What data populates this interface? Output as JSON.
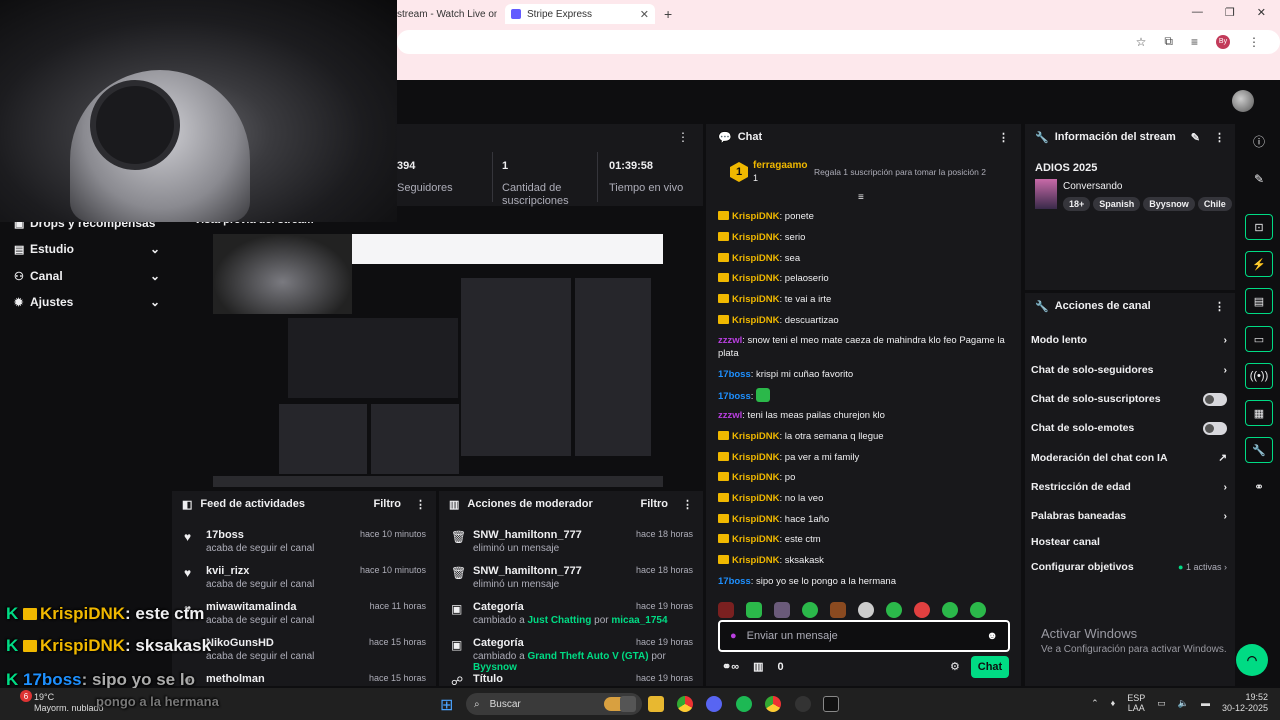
{
  "browser": {
    "tab1_title": "stream - Watch Live on",
    "tab2_title": "Stripe Express",
    "tab_close": "✕",
    "new_tab": "+",
    "profile_initials": "By"
  },
  "stats": {
    "followers_value": "394",
    "followers_label": "Seguidores",
    "subs_value": "1",
    "subs_label": "Cantidad de suscripciones",
    "live_value": "01:39:58",
    "live_label": "Tiempo en vivo"
  },
  "nav": {
    "drops": "Drops y recompensas",
    "studio": "Estudio",
    "channel": "Canal",
    "settings": "Ajustes"
  },
  "preview": {
    "title": "Vista previa del stream"
  },
  "feed": {
    "title": "Feed de actividades",
    "filter": "Filtro",
    "items": [
      {
        "name": "17boss",
        "sub": "acaba de seguir el canal",
        "time": "hace 10 minutos"
      },
      {
        "name": "kvii_rizx",
        "sub": "acaba de seguir el canal",
        "time": "hace 10 minutos"
      },
      {
        "name": "miwawitamalinda",
        "sub": "acaba de seguir el canal",
        "time": "hace 11 horas"
      },
      {
        "name": "NikoGunsHD",
        "sub": "acaba de seguir el canal",
        "time": "hace 15 horas"
      },
      {
        "name": "metholman",
        "sub": "",
        "time": "hace 15 horas"
      }
    ]
  },
  "mod": {
    "title": "Acciones de moderador",
    "filter": "Filtro",
    "items": [
      {
        "name": "SNW_hamiltonn_777",
        "sub": "eliminó un mensaje",
        "time": "hace 18 horas"
      },
      {
        "name": "SNW_hamiltonn_777",
        "sub": "eliminó un mensaje",
        "time": "hace 18 horas"
      },
      {
        "name": "Categoría",
        "sub_pre": "cambiado a ",
        "sub_hl": "Just Chatting",
        "sub_mid": " por ",
        "sub_user": "micaa_1754",
        "time": "hace 19 horas"
      },
      {
        "name": "Categoría",
        "sub_pre": "cambiado a ",
        "sub_hl": "Grand Theft Auto V (GTA)",
        "sub_mid": " por ",
        "sub_user": "Byysnow",
        "time": "hace 19 horas"
      },
      {
        "name": "Título",
        "time": "hace 19 horas"
      }
    ]
  },
  "chat": {
    "title": "Chat",
    "top_rank": "1",
    "top_user": "ferragaamo",
    "top_count": "1",
    "gift_prompt": "Regala 1 suscripción para tomar la posición 2",
    "messages": [
      {
        "user": "KrispiDNK",
        "text": ": ponete",
        "style": "u1",
        "badge": true
      },
      {
        "user": "KrispiDNK",
        "text": ": serio",
        "style": "u1",
        "badge": true
      },
      {
        "user": "KrispiDNK",
        "text": ": sea",
        "style": "u1",
        "badge": true
      },
      {
        "user": "KrispiDNK",
        "text": ": pelaoserio",
        "style": "u1",
        "badge": true
      },
      {
        "user": "KrispiDNK",
        "text": ": te vai a irte",
        "style": "u1",
        "badge": true
      },
      {
        "user": "KrispiDNK",
        "text": ": descuartizao",
        "style": "u1",
        "badge": true
      },
      {
        "user": "zzzwl",
        "text": ": snow teni el meo mate caeza de mahindra klo feo Pagame la plata",
        "style": "u3",
        "badge": false
      },
      {
        "user": "17boss",
        "text": ": krispi mi cuñao favorito",
        "style": "u2",
        "badge": false
      },
      {
        "user": "17boss",
        "text": ":",
        "style": "u2",
        "badge": false
      },
      {
        "user": "zzzwl",
        "text": ": teni las meas pailas churejon klo",
        "style": "u3",
        "badge": false
      },
      {
        "user": "KrispiDNK",
        "text": ": la otra semana q llegue",
        "style": "u1",
        "badge": true
      },
      {
        "user": "KrispiDNK",
        "text": ": pa ver a mi family",
        "style": "u1",
        "badge": true
      },
      {
        "user": "KrispiDNK",
        "text": ": po",
        "style": "u1",
        "badge": true
      },
      {
        "user": "KrispiDNK",
        "text": ": no la veo",
        "style": "u1",
        "badge": true
      },
      {
        "user": "KrispiDNK",
        "text": ": hace 1año",
        "style": "u1",
        "badge": true
      },
      {
        "user": "KrispiDNK",
        "text": ": este ctm",
        "style": "u1",
        "badge": true
      },
      {
        "user": "KrispiDNK",
        "text": ": sksakask",
        "style": "u1",
        "badge": true
      },
      {
        "user": "17boss",
        "text": ": sipo yo se lo pongo a la hermana",
        "style": "u2",
        "badge": false
      }
    ],
    "input_placeholder": "Enviar un mensaje",
    "send": "Chat",
    "points": "0"
  },
  "info": {
    "title": "Información del stream",
    "stream_title": "ADIOS 2025",
    "category": "Conversando",
    "tags": [
      "18+",
      "Spanish",
      "Byysnow",
      "Chile"
    ]
  },
  "actions": {
    "title": "Acciones de canal",
    "items": [
      "Modo lento",
      "Chat de solo-seguidores",
      "Chat de solo-suscriptores",
      "Chat de solo-emotes",
      "Moderación del chat con IA",
      "Restricción de edad",
      "Palabras baneadas",
      "Hostear canal",
      "Configurar objetivos"
    ],
    "goals_active": "1 activas"
  },
  "windows": {
    "activate_title": "Activar Windows",
    "activate_sub": "Ve a Configuración para activar Windows."
  },
  "overlay": {
    "l1_user": "KrispiDNK",
    "l1_text": ": este ctm",
    "l2_user": "KrispiDNK",
    "l2_text": ": sksakask",
    "l3_user": "17boss",
    "l3_text": ": sipo yo se lo",
    "l4_text": "pongo a la hermana"
  },
  "taskbar": {
    "temp": "19°C",
    "weather": "Mayorm. nublado",
    "search": "Buscar",
    "lang1": "ESP",
    "lang2": "LAA",
    "time": "19:52",
    "date": "30-12-2025",
    "notif": "6"
  },
  "colors": {
    "accent": "#00db84",
    "bg": "#0e0e10",
    "panel": "#18181b"
  }
}
